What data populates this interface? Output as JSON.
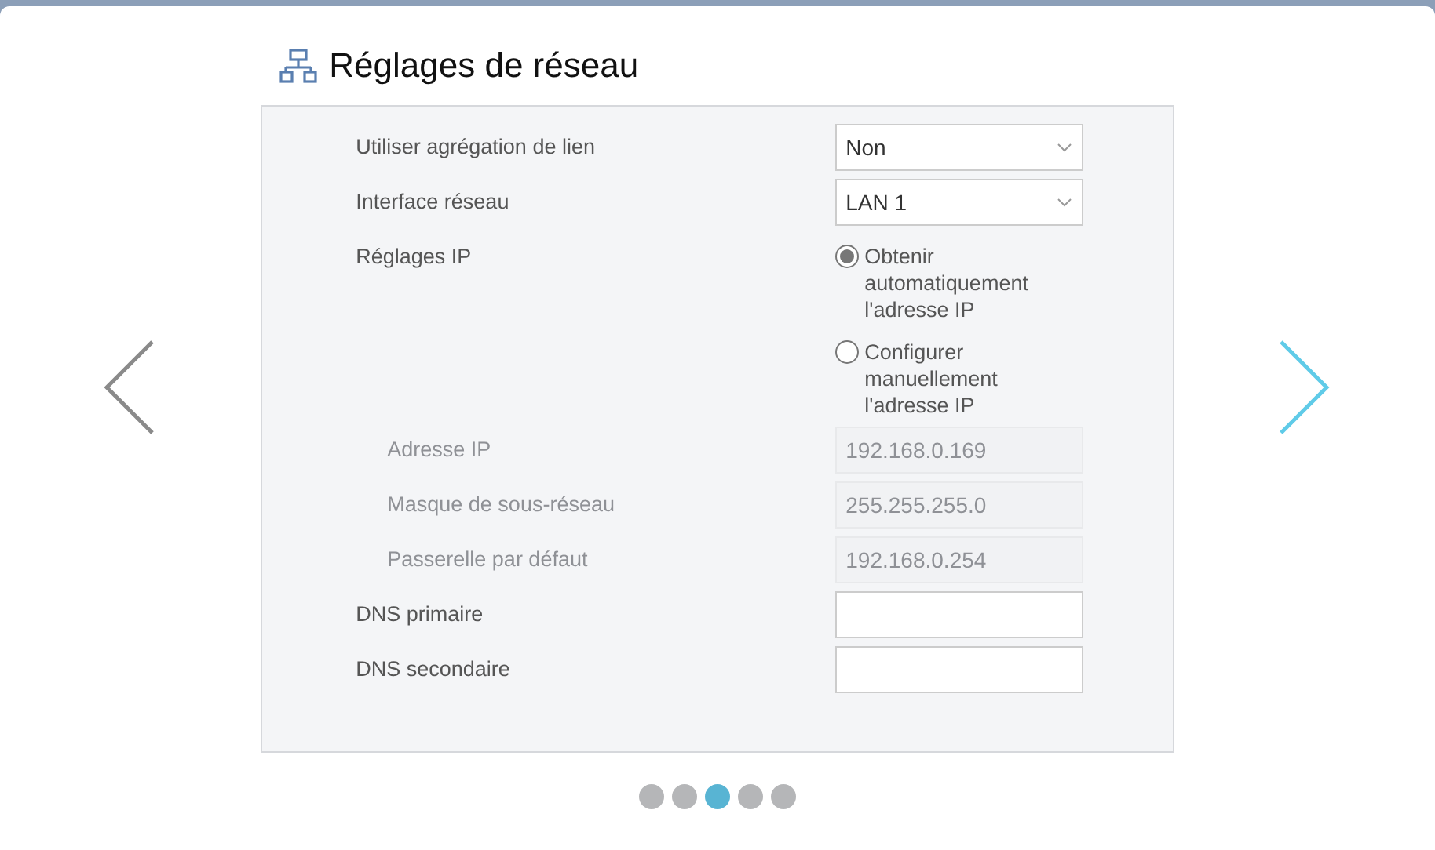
{
  "title": "Réglages de réseau",
  "fields": [
    {
      "kind": "select",
      "label": "Utiliser agrégation de lien",
      "value": "Non",
      "disabled": false
    },
    {
      "kind": "select",
      "label": "Interface réseau",
      "value": "LAN 1",
      "disabled": false
    },
    {
      "kind": "radio",
      "label": "Réglages IP",
      "options": [
        {
          "label": "Obtenir automatiquement l'adresse IP",
          "selected": true
        },
        {
          "label": "Configurer manuellement l'adresse IP",
          "selected": false
        }
      ]
    },
    {
      "kind": "input",
      "label": "Adresse IP",
      "value": "192.168.0.169",
      "disabled": true
    },
    {
      "kind": "input",
      "label": "Masque de sous-réseau",
      "value": "255.255.255.0",
      "disabled": true
    },
    {
      "kind": "input",
      "label": "Passerelle par défaut",
      "value": "192.168.0.254",
      "disabled": true
    },
    {
      "kind": "input",
      "label": "DNS primaire",
      "disabled": false
    },
    {
      "kind": "input",
      "label": "DNS secondaire",
      "disabled": false
    }
  ],
  "nav": [
    {
      "kind": "prev",
      "highlighted": false
    },
    {
      "kind": "next",
      "highlighted": true
    }
  ],
  "pages": [
    {
      "selected": false
    },
    {
      "selected": false
    },
    {
      "selected": true
    },
    {
      "selected": false
    },
    {
      "selected": false
    }
  ]
}
